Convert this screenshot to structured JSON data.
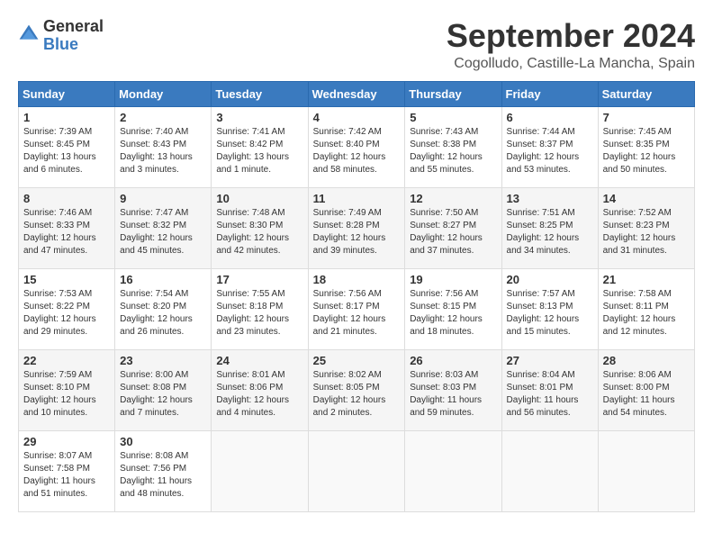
{
  "header": {
    "logo_general": "General",
    "logo_blue": "Blue",
    "month_title": "September 2024",
    "location": "Cogolludo, Castille-La Mancha, Spain"
  },
  "weekdays": [
    "Sunday",
    "Monday",
    "Tuesday",
    "Wednesday",
    "Thursday",
    "Friday",
    "Saturday"
  ],
  "weeks": [
    [
      {
        "day": "1",
        "sunrise": "7:39 AM",
        "sunset": "8:45 PM",
        "daylight": "13 hours and 6 minutes."
      },
      {
        "day": "2",
        "sunrise": "7:40 AM",
        "sunset": "8:43 PM",
        "daylight": "13 hours and 3 minutes."
      },
      {
        "day": "3",
        "sunrise": "7:41 AM",
        "sunset": "8:42 PM",
        "daylight": "13 hours and 1 minute."
      },
      {
        "day": "4",
        "sunrise": "7:42 AM",
        "sunset": "8:40 PM",
        "daylight": "12 hours and 58 minutes."
      },
      {
        "day": "5",
        "sunrise": "7:43 AM",
        "sunset": "8:38 PM",
        "daylight": "12 hours and 55 minutes."
      },
      {
        "day": "6",
        "sunrise": "7:44 AM",
        "sunset": "8:37 PM",
        "daylight": "12 hours and 53 minutes."
      },
      {
        "day": "7",
        "sunrise": "7:45 AM",
        "sunset": "8:35 PM",
        "daylight": "12 hours and 50 minutes."
      }
    ],
    [
      {
        "day": "8",
        "sunrise": "7:46 AM",
        "sunset": "8:33 PM",
        "daylight": "12 hours and 47 minutes."
      },
      {
        "day": "9",
        "sunrise": "7:47 AM",
        "sunset": "8:32 PM",
        "daylight": "12 hours and 45 minutes."
      },
      {
        "day": "10",
        "sunrise": "7:48 AM",
        "sunset": "8:30 PM",
        "daylight": "12 hours and 42 minutes."
      },
      {
        "day": "11",
        "sunrise": "7:49 AM",
        "sunset": "8:28 PM",
        "daylight": "12 hours and 39 minutes."
      },
      {
        "day": "12",
        "sunrise": "7:50 AM",
        "sunset": "8:27 PM",
        "daylight": "12 hours and 37 minutes."
      },
      {
        "day": "13",
        "sunrise": "7:51 AM",
        "sunset": "8:25 PM",
        "daylight": "12 hours and 34 minutes."
      },
      {
        "day": "14",
        "sunrise": "7:52 AM",
        "sunset": "8:23 PM",
        "daylight": "12 hours and 31 minutes."
      }
    ],
    [
      {
        "day": "15",
        "sunrise": "7:53 AM",
        "sunset": "8:22 PM",
        "daylight": "12 hours and 29 minutes."
      },
      {
        "day": "16",
        "sunrise": "7:54 AM",
        "sunset": "8:20 PM",
        "daylight": "12 hours and 26 minutes."
      },
      {
        "day": "17",
        "sunrise": "7:55 AM",
        "sunset": "8:18 PM",
        "daylight": "12 hours and 23 minutes."
      },
      {
        "day": "18",
        "sunrise": "7:56 AM",
        "sunset": "8:17 PM",
        "daylight": "12 hours and 21 minutes."
      },
      {
        "day": "19",
        "sunrise": "7:56 AM",
        "sunset": "8:15 PM",
        "daylight": "12 hours and 18 minutes."
      },
      {
        "day": "20",
        "sunrise": "7:57 AM",
        "sunset": "8:13 PM",
        "daylight": "12 hours and 15 minutes."
      },
      {
        "day": "21",
        "sunrise": "7:58 AM",
        "sunset": "8:11 PM",
        "daylight": "12 hours and 12 minutes."
      }
    ],
    [
      {
        "day": "22",
        "sunrise": "7:59 AM",
        "sunset": "8:10 PM",
        "daylight": "12 hours and 10 minutes."
      },
      {
        "day": "23",
        "sunrise": "8:00 AM",
        "sunset": "8:08 PM",
        "daylight": "12 hours and 7 minutes."
      },
      {
        "day": "24",
        "sunrise": "8:01 AM",
        "sunset": "8:06 PM",
        "daylight": "12 hours and 4 minutes."
      },
      {
        "day": "25",
        "sunrise": "8:02 AM",
        "sunset": "8:05 PM",
        "daylight": "12 hours and 2 minutes."
      },
      {
        "day": "26",
        "sunrise": "8:03 AM",
        "sunset": "8:03 PM",
        "daylight": "11 hours and 59 minutes."
      },
      {
        "day": "27",
        "sunrise": "8:04 AM",
        "sunset": "8:01 PM",
        "daylight": "11 hours and 56 minutes."
      },
      {
        "day": "28",
        "sunrise": "8:06 AM",
        "sunset": "8:00 PM",
        "daylight": "11 hours and 54 minutes."
      }
    ],
    [
      {
        "day": "29",
        "sunrise": "8:07 AM",
        "sunset": "7:58 PM",
        "daylight": "11 hours and 51 minutes."
      },
      {
        "day": "30",
        "sunrise": "8:08 AM",
        "sunset": "7:56 PM",
        "daylight": "11 hours and 48 minutes."
      },
      null,
      null,
      null,
      null,
      null
    ]
  ]
}
